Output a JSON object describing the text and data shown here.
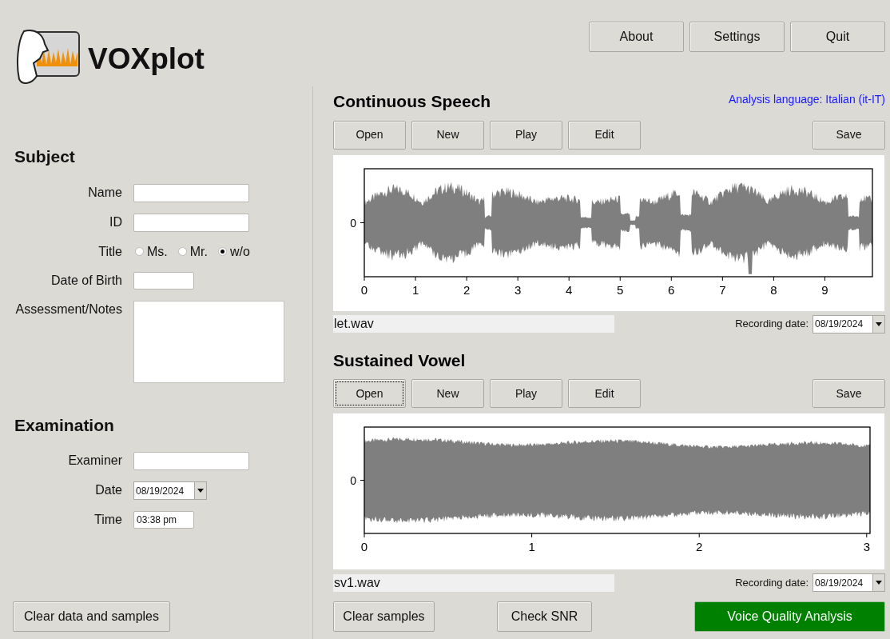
{
  "app": {
    "title": "VOXplot"
  },
  "top_buttons": [
    "About",
    "Settings",
    "Quit"
  ],
  "subject": {
    "heading": "Subject",
    "fields": [
      {
        "kind": "text",
        "label": "Name"
      },
      {
        "kind": "text",
        "label": "ID"
      },
      {
        "kind": "radio",
        "label": "Title",
        "options": [
          {
            "label": "Ms.",
            "selected": false
          },
          {
            "label": "Mr.",
            "selected": false
          },
          {
            "label": "w/o",
            "selected": true
          }
        ]
      },
      {
        "kind": "short",
        "label": "Date of Birth"
      },
      {
        "kind": "notes",
        "label": "Assessment/Notes"
      }
    ]
  },
  "examination": {
    "heading": "Examination",
    "fields": [
      {
        "kind": "text",
        "label": "Examiner"
      },
      {
        "kind": "date",
        "label": "Date",
        "value": "08/19/2024"
      },
      {
        "kind": "short",
        "label": "Time",
        "value": "03:38 pm"
      }
    ]
  },
  "clear_all_button": "Clear data and samples",
  "analysis_language": "Analysis language: Italian (it-IT)",
  "sections": [
    {
      "title": "Continuous Speech",
      "kind": "speech",
      "buttons": [
        {
          "label": "Open",
          "focused": false
        },
        {
          "label": "New",
          "focused": false
        },
        {
          "label": "Play",
          "focused": false
        },
        {
          "label": "Edit",
          "focused": false
        },
        {
          "label": "Save",
          "focused": false
        }
      ],
      "y_tick": "0",
      "x_ticks": [
        "0",
        "1",
        "2",
        "3",
        "4",
        "5",
        "6",
        "7",
        "8",
        "9"
      ],
      "file": "let.wav",
      "date_label": "Recording date:",
      "date": "08/19/2024"
    },
    {
      "title": "Sustained Vowel",
      "kind": "vowel",
      "buttons": [
        {
          "label": "Open",
          "focused": true
        },
        {
          "label": "New",
          "focused": false
        },
        {
          "label": "Play",
          "focused": false
        },
        {
          "label": "Edit",
          "focused": false
        },
        {
          "label": "Save",
          "focused": false
        }
      ],
      "y_tick": "0",
      "x_ticks": [
        "0",
        "1",
        "2",
        "3"
      ],
      "file": "sv1.wav",
      "date_label": "Recording date:",
      "date": "08/19/2024"
    }
  ],
  "bottom_buttons": [
    {
      "label": "Clear samples",
      "kind": "normal"
    },
    {
      "label": "Check SNR",
      "kind": "normal"
    },
    {
      "label": "Voice Quality Analysis",
      "kind": "primary"
    }
  ]
}
